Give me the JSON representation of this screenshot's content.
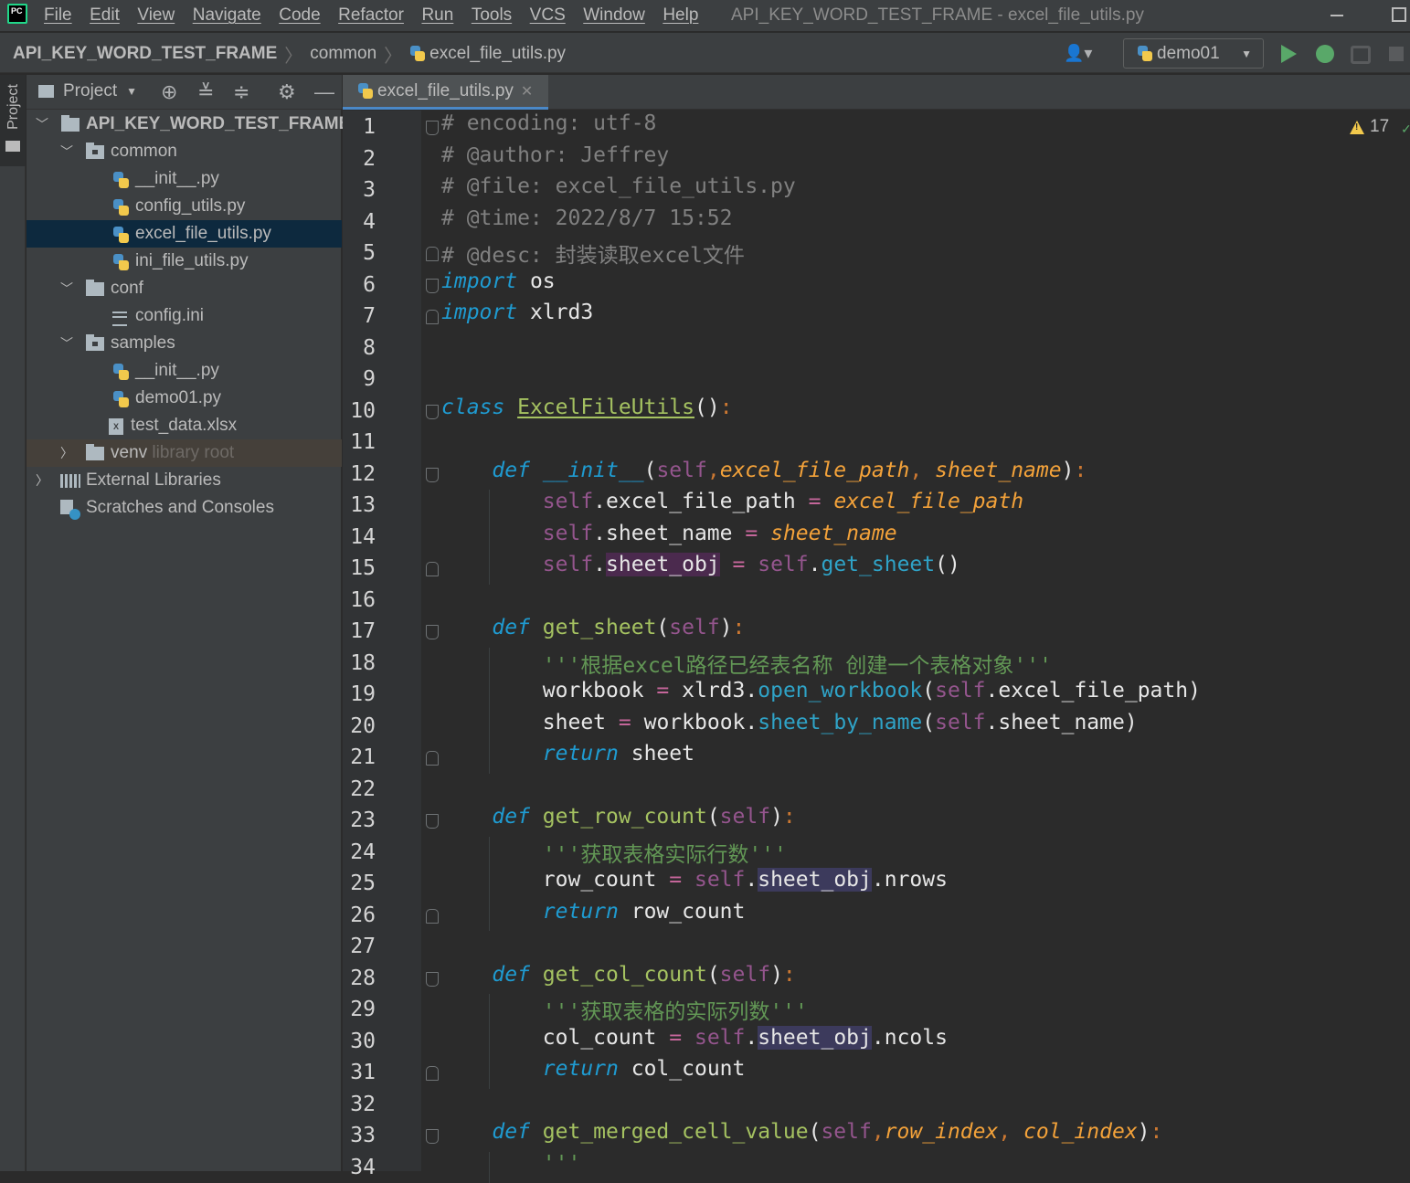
{
  "menubar": {
    "items": [
      "File",
      "Edit",
      "View",
      "Navigate",
      "Code",
      "Refactor",
      "Run",
      "Tools",
      "VCS",
      "Window",
      "Help"
    ],
    "window_title": "API_KEY_WORD_TEST_FRAME - excel_file_utils.py",
    "logo_text": "PC"
  },
  "navbar": {
    "breadcrumb": [
      "API_KEY_WORD_TEST_FRAME",
      "common",
      "excel_file_utils.py"
    ],
    "run_config": "demo01"
  },
  "stripe": {
    "label": "Project"
  },
  "project_panel": {
    "title": "Project",
    "tree": [
      {
        "label": "API_KEY_WORD_TEST_FRAME",
        "type": "folder",
        "depth": 0,
        "expanded": true
      },
      {
        "label": "common",
        "type": "module",
        "depth": 1,
        "expanded": true
      },
      {
        "label": "__init__.py",
        "type": "py",
        "depth": 2
      },
      {
        "label": "config_utils.py",
        "type": "py",
        "depth": 2
      },
      {
        "label": "excel_file_utils.py",
        "type": "py",
        "depth": 2,
        "selected": true
      },
      {
        "label": "ini_file_utils.py",
        "type": "py",
        "depth": 2
      },
      {
        "label": "conf",
        "type": "folder",
        "depth": 1,
        "expanded": true
      },
      {
        "label": "config.ini",
        "type": "ini",
        "depth": 2
      },
      {
        "label": "samples",
        "type": "module",
        "depth": 1,
        "expanded": true
      },
      {
        "label": "__init__.py",
        "type": "py",
        "depth": 2
      },
      {
        "label": "demo01.py",
        "type": "py",
        "depth": 2
      },
      {
        "label": "test_data.xlsx",
        "type": "xls",
        "depth": 2
      },
      {
        "label": "venv",
        "type": "folder",
        "depth": 1,
        "expanded": false,
        "hint": "library root"
      },
      {
        "label": "External Libraries",
        "type": "lib",
        "depth": 0,
        "expanded": false
      },
      {
        "label": "Scratches and Consoles",
        "type": "scratch",
        "depth": 0
      }
    ]
  },
  "editor": {
    "tab_label": "excel_file_utils.py",
    "warning_count": "17",
    "lines": [
      "# encoding: utf-8",
      "# @author: Jeffrey",
      "# @file: excel_file_utils.py",
      "# @time: 2022/8/7 15:52",
      "# @desc: 封装读取excel文件",
      "import os",
      "import xlrd3",
      "",
      "",
      "class ExcelFileUtils():",
      "",
      "    def __init__(self,excel_file_path, sheet_name):",
      "        self.excel_file_path = excel_file_path",
      "        self.sheet_name = sheet_name",
      "        self.sheet_obj = self.get_sheet()",
      "",
      "    def get_sheet(self):",
      "        '''根据excel路径已经表名称 创建一个表格对象'''",
      "        workbook = xlrd3.open_workbook(self.excel_file_path)",
      "        sheet = workbook.sheet_by_name(self.sheet_name)",
      "        return sheet",
      "",
      "    def get_row_count(self):",
      "        '''获取表格实际行数'''",
      "        row_count = self.sheet_obj.nrows",
      "        return row_count",
      "",
      "    def get_col_count(self):",
      "        '''获取表格的实际列数'''",
      "        col_count = self.sheet_obj.ncols",
      "        return col_count",
      "",
      "    def get_merged_cell_value(self,row_index, col_index):",
      "        '''"
    ]
  },
  "colors": {
    "accent_blue": "#4a88c7",
    "run_green": "#59a869",
    "selection": "#0d293e"
  }
}
